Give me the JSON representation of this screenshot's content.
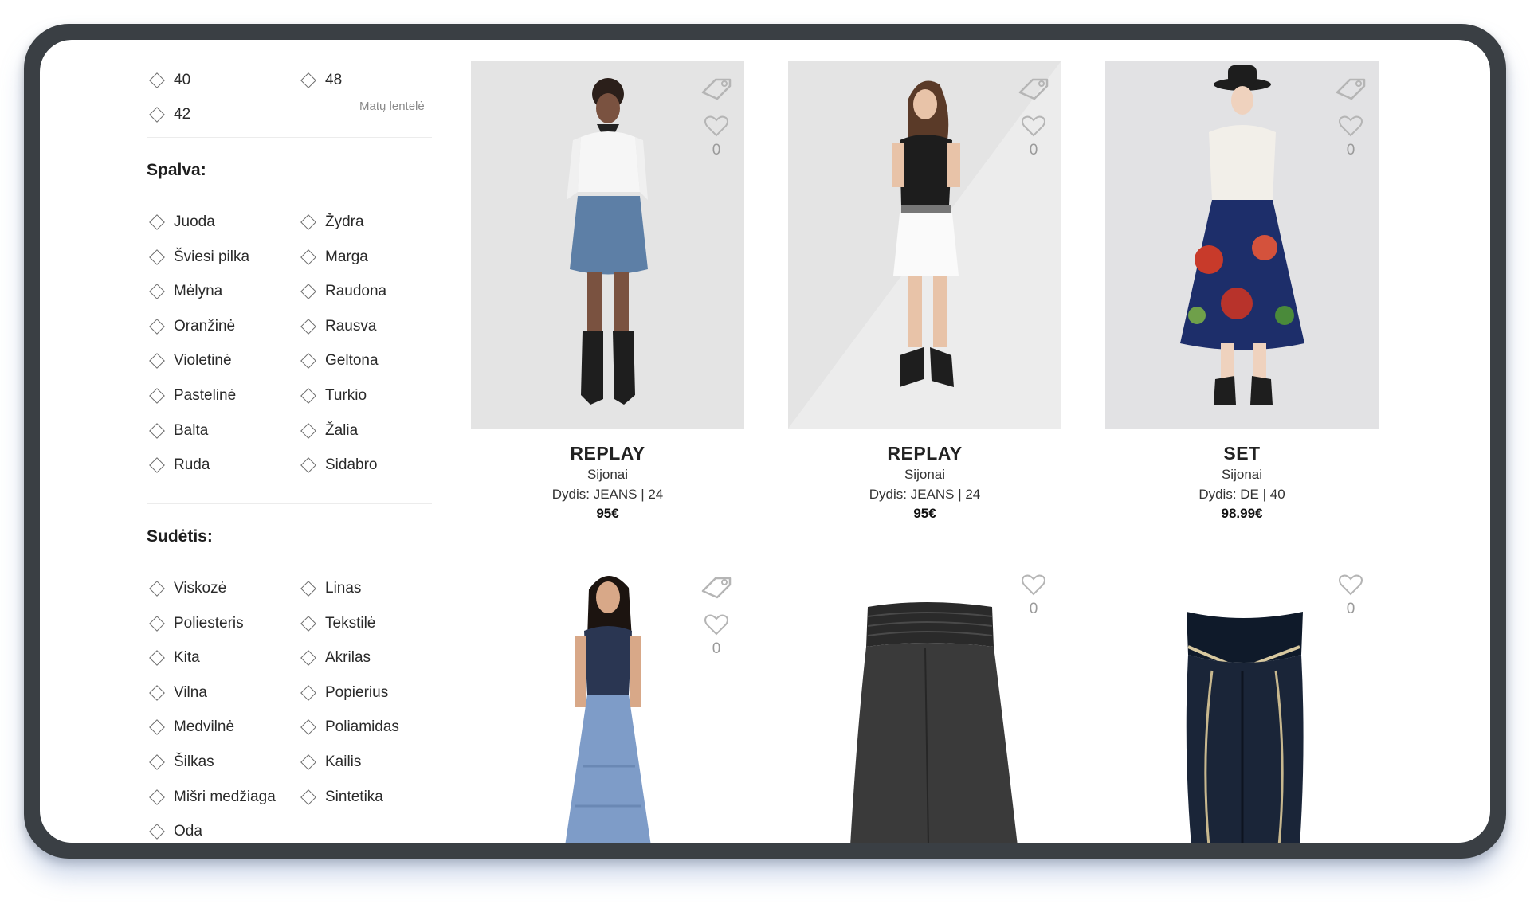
{
  "filters": {
    "size": {
      "options": [
        "40",
        "48",
        "42"
      ],
      "size_table_link": "Matų lentelė"
    },
    "color": {
      "title": "Spalva:",
      "options": [
        "Juoda",
        "Žydra",
        "Šviesi pilka",
        "Marga",
        "Mėlyna",
        "Raudona",
        "Oranžinė",
        "Rausva",
        "Violetinė",
        "Geltona",
        "Pastelinė",
        "Turkio",
        "Balta",
        "Žalia",
        "Ruda",
        "Sidabro"
      ]
    },
    "composition": {
      "title": "Sudėtis:",
      "options": [
        "Viskozė",
        "Linas",
        "Poliesteris",
        "Tekstilė",
        "Kita",
        "Akrilas",
        "Vilna",
        "Popierius",
        "Medvilnė",
        "Poliamidas",
        "Šilkas",
        "Kailis",
        "Mišri medžiaga",
        "Sintetika",
        "Oda"
      ]
    }
  },
  "products": [
    {
      "brand": "REPLAY",
      "category": "Sijonai",
      "size": "Dydis: JEANS | 24",
      "price": "95€",
      "likes": "0"
    },
    {
      "brand": "REPLAY",
      "category": "Sijonai",
      "size": "Dydis: JEANS | 24",
      "price": "95€",
      "likes": "0"
    },
    {
      "brand": "SET",
      "category": "Sijonai",
      "size": "Dydis: DE | 40",
      "price": "98.99€",
      "likes": "0"
    },
    {
      "likes": "0"
    },
    {
      "likes": "0"
    },
    {
      "likes": "0"
    }
  ],
  "colors": {
    "frame": "#3a3f44",
    "image_bg": "#e4e4e4",
    "icon_gray": "#b5b5b5"
  }
}
